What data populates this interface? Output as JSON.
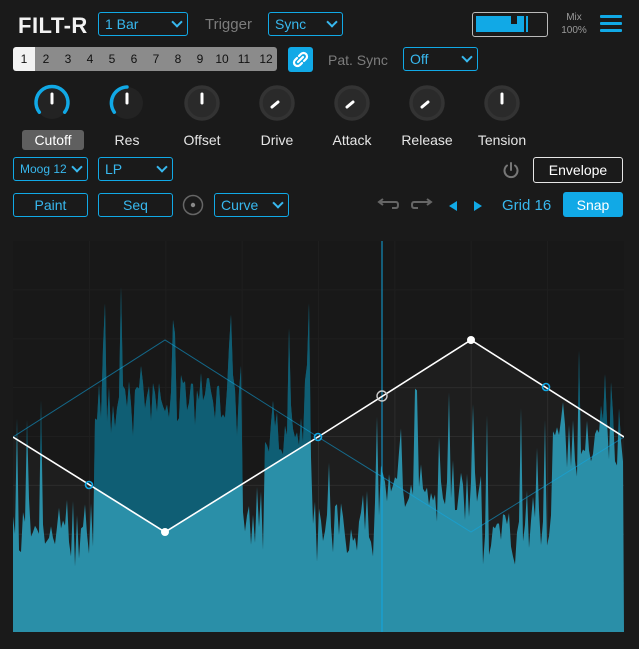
{
  "header": {
    "title": "FILT-R",
    "length_value": "1 Bar",
    "trigger_label": "Trigger",
    "trigger_value": "Sync",
    "mix_label": "Mix",
    "mix_value": "100%"
  },
  "steps": {
    "items": [
      "1",
      "2",
      "3",
      "4",
      "5",
      "6",
      "7",
      "8",
      "9",
      "10",
      "11",
      "12"
    ],
    "selected": "1",
    "pat_sync_label": "Pat. Sync",
    "pat_sync_value": "Off"
  },
  "knobs": [
    {
      "label": "Cutoff",
      "active": true
    },
    {
      "label": "Res",
      "active": true
    },
    {
      "label": "Offset",
      "active": false
    },
    {
      "label": "Drive",
      "active": false
    },
    {
      "label": "Attack",
      "active": false
    },
    {
      "label": "Release",
      "active": false
    },
    {
      "label": "Tension",
      "active": false
    }
  ],
  "filter": {
    "model_value": "Moog 12",
    "type_value": "LP",
    "envelope_label": "Envelope"
  },
  "editor": {
    "paint_label": "Paint",
    "seq_label": "Seq",
    "curve_value": "Curve",
    "grid_label": "Grid 16",
    "snap_label": "Snap"
  },
  "icons": {
    "menu": "hamburger-menu-icon",
    "link": "link-icon",
    "power": "power-icon",
    "radio": "radio-icon",
    "undo": "undo-arrow-icon",
    "redo": "redo-arrow-icon",
    "prev": "triangle-left-icon",
    "next": "triangle-right-icon"
  },
  "colors": {
    "accent": "#11a9e6",
    "background": "#1a1a1a",
    "graph_bg": "#1e1e1e",
    "waveform": "#2a8fa8"
  }
}
